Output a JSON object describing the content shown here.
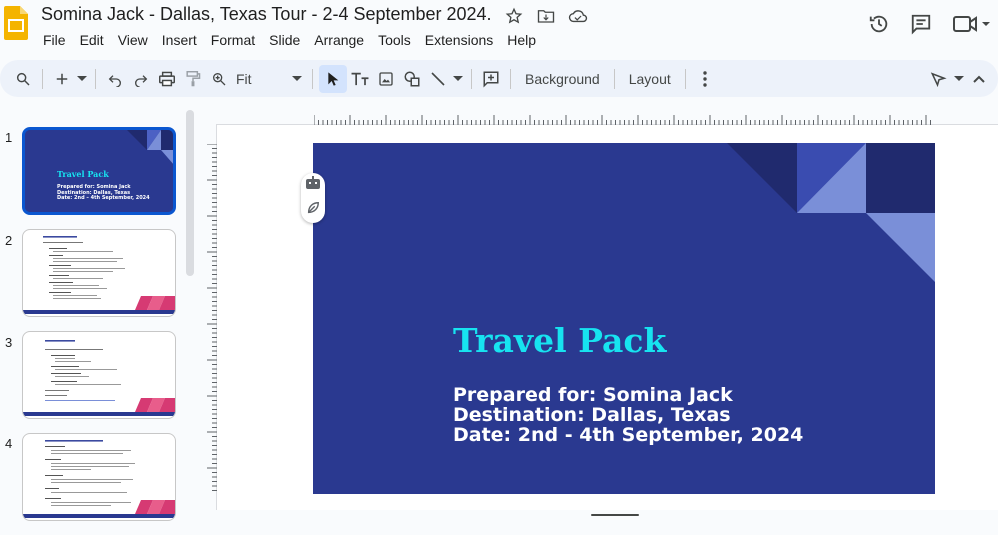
{
  "app": {
    "title": "Somina Jack - Dallas, Texas Tour - 2-4 September 2024.",
    "logo_icon": "google-slides-logo",
    "brand_color": "#f4b400"
  },
  "menu": [
    "File",
    "Edit",
    "View",
    "Insert",
    "Format",
    "Slide",
    "Arrange",
    "Tools",
    "Extensions",
    "Help"
  ],
  "toolbar": {
    "zoom_value": "Fit",
    "background_label": "Background",
    "layout_label": "Layout"
  },
  "thumbnails": [
    {
      "number": "1",
      "title": "Travel Pack",
      "lines": [
        "Prepared for: Somina Jack",
        "Destination: Dallas, Texas",
        "Date: 2nd – 4th September, 2024"
      ]
    },
    {
      "number": "2"
    },
    {
      "number": "3"
    },
    {
      "number": "4"
    }
  ],
  "slide": {
    "title": "Travel Pack",
    "line1": "Prepared for: Somina Jack",
    "line2": "Destination: Dallas, Texas",
    "line3": "Date: 2nd - 4th September, 2024",
    "background_color": "#2a3990",
    "title_color": "#17e3f0"
  }
}
